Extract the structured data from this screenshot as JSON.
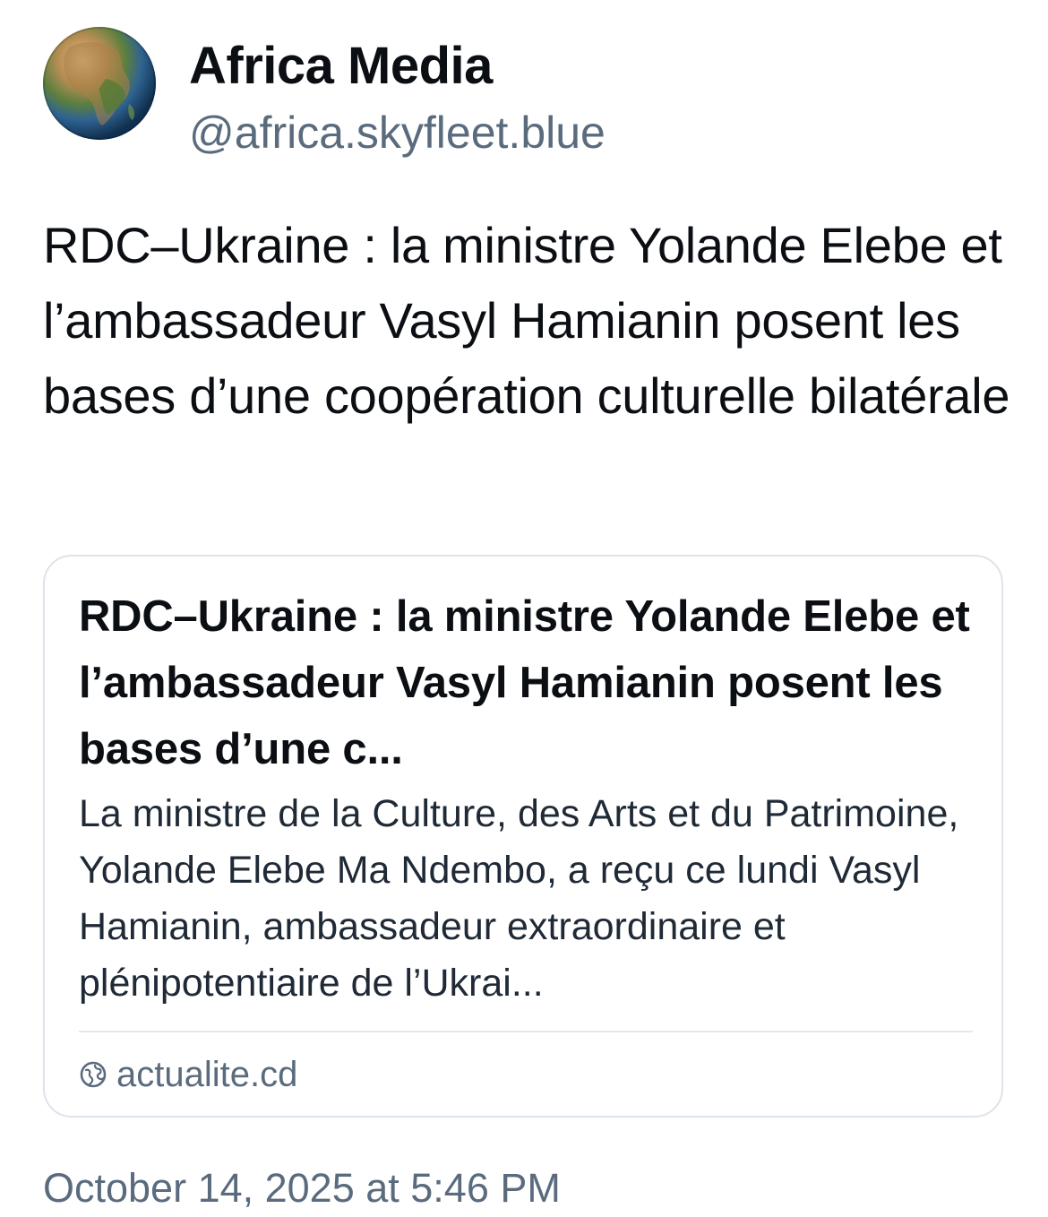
{
  "author": {
    "display_name": "Africa Media",
    "handle": "@africa.skyfleet.blue",
    "avatar_icon": "earth-africa-avatar"
  },
  "post": {
    "text": "RDC–Ukraine : la ministre Yolande Elebe et l’ambassadeur Vasyl Hamianin posent les bases d’une coopération culturelle bilatérale",
    "timestamp": "October 14, 2025 at 5:46 PM"
  },
  "link_card": {
    "title": "RDC–Ukraine : la ministre Yolande Elebe et l’ambassadeur Vasyl Hamianin posent les bases d’une c...",
    "description": "La ministre de la Culture, des Arts et du Patrimoine, Yolande Elebe Ma Ndembo, a reçu ce lundi Vasyl Hamianin, ambassadeur extraordinaire et plénipotentiaire de l’Ukrai...",
    "domain": "actualite.cd",
    "domain_icon": "globe-icon"
  },
  "colors": {
    "text_primary": "#0b0f14",
    "text_secondary": "#5a6b7e",
    "card_border": "#dde3ea"
  }
}
